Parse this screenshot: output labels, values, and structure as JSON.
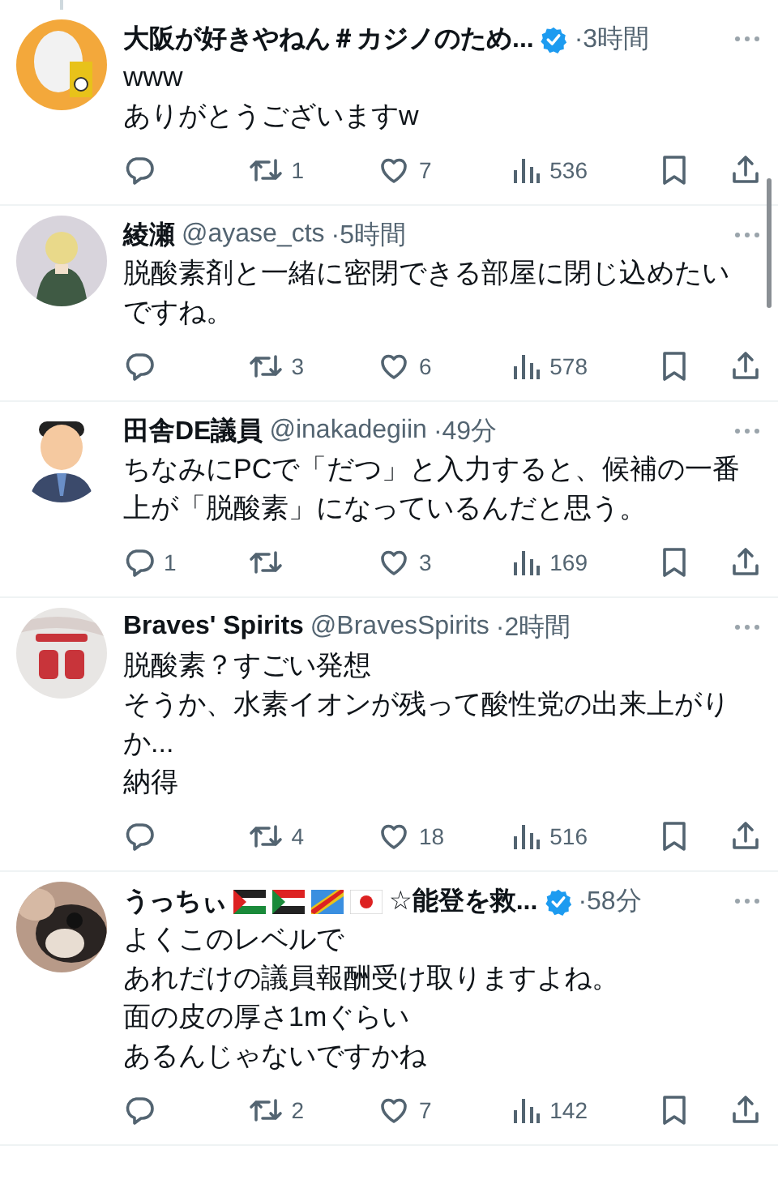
{
  "tweets": [
    {
      "avatar": {
        "kind": "ring"
      },
      "name": "大阪が好きやねん＃カジノのため...",
      "verified": true,
      "time": "·3時間",
      "lines": [
        "www",
        "ありがとうございますw"
      ],
      "actions": [
        {
          "kind": "reply"
        },
        {
          "kind": "retweet",
          "count": "1"
        },
        {
          "kind": "like",
          "count": "7"
        },
        {
          "kind": "views",
          "count": "536"
        },
        {
          "kind": "bookmark"
        },
        {
          "kind": "share"
        }
      ]
    },
    {
      "avatar": {
        "kind": "figure"
      },
      "name": "綾瀬",
      "handle": "@ayase_cts",
      "verified": false,
      "time": "·5時間",
      "lines": [
        "脱酸素剤と一緒に密閉できる部屋に閉じ込めたいですね。"
      ],
      "actions": [
        {
          "kind": "reply"
        },
        {
          "kind": "retweet",
          "count": "3"
        },
        {
          "kind": "like",
          "count": "6"
        },
        {
          "kind": "views",
          "count": "578"
        },
        {
          "kind": "bookmark"
        },
        {
          "kind": "share"
        }
      ]
    },
    {
      "avatar": {
        "kind": "suit"
      },
      "name": "田舎DE議員",
      "handle": "@inakadegiin",
      "verified": false,
      "time": "·49分",
      "lines": [
        "ちなみにPCで「だつ」と入力すると、候補の一番上が「脱酸素」になっているんだと思う。"
      ],
      "actions": [
        {
          "kind": "reply",
          "count": "1"
        },
        {
          "kind": "retweet"
        },
        {
          "kind": "like",
          "count": "3"
        },
        {
          "kind": "views",
          "count": "169"
        },
        {
          "kind": "bookmark"
        },
        {
          "kind": "share"
        }
      ]
    },
    {
      "avatar": {
        "kind": "jersey"
      },
      "name": "Braves' Spirits",
      "handle": "@BravesSpirits",
      "verified": false,
      "time": "·2時間",
      "lines": [
        "脱酸素？すごい発想",
        "そうか、水素イオンが残って酸性党の出来上がりか...",
        "納得"
      ],
      "actions": [
        {
          "kind": "reply"
        },
        {
          "kind": "retweet",
          "count": "4"
        },
        {
          "kind": "like",
          "count": "18"
        },
        {
          "kind": "views",
          "count": "516"
        },
        {
          "kind": "bookmark"
        },
        {
          "kind": "share"
        }
      ]
    },
    {
      "avatar": {
        "kind": "pet"
      },
      "name": "うっちぃ",
      "flags": [
        {
          "kind": "palestine"
        },
        {
          "kind": "sudan"
        },
        {
          "kind": "congo"
        },
        {
          "kind": "japan"
        }
      ],
      "name_suffix": "☆能登を救...",
      "verified": true,
      "time": "·58分",
      "lines": [
        "よくこのレベルで",
        "あれだけの議員報酬受け取りますよね。",
        "面の皮の厚さ1mぐらい",
        "あるんじゃないですかね"
      ],
      "actions": [
        {
          "kind": "reply"
        },
        {
          "kind": "retweet",
          "count": "2"
        },
        {
          "kind": "like",
          "count": "7"
        },
        {
          "kind": "views",
          "count": "142"
        },
        {
          "kind": "bookmark"
        },
        {
          "kind": "share"
        }
      ]
    }
  ]
}
